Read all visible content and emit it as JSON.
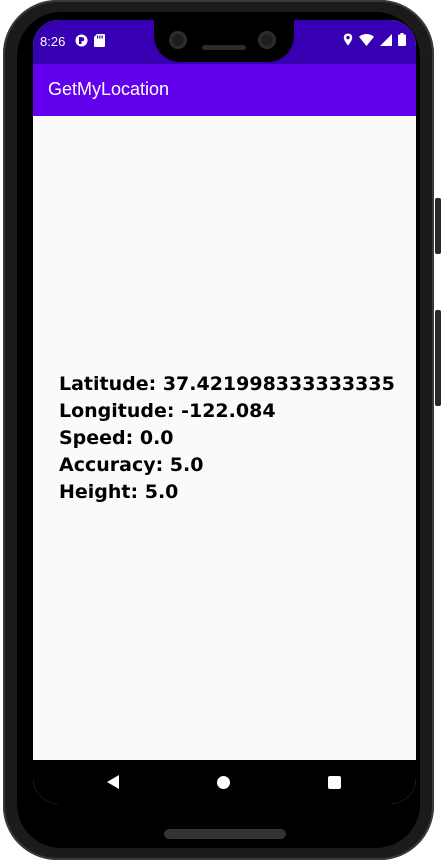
{
  "status_bar": {
    "time": "8:26",
    "left_icons": [
      "photo-lock-icon",
      "sd-card-icon"
    ],
    "right_icons": [
      "location-pin-icon",
      "wifi-icon",
      "signal-icon",
      "battery-icon"
    ],
    "color": "#3700b3"
  },
  "app_bar": {
    "title": "GetMyLocation",
    "color": "#6200ee"
  },
  "location": {
    "latitude": "Latitude: 37.421998333333335",
    "longitude": "Longitude: -122.084",
    "speed": "Speed: 0.0",
    "accuracy": "Accuracy: 5.0",
    "height": "Height: 5.0"
  },
  "nav_bar": {
    "buttons": [
      "back-icon",
      "home-icon",
      "recents-icon"
    ]
  }
}
